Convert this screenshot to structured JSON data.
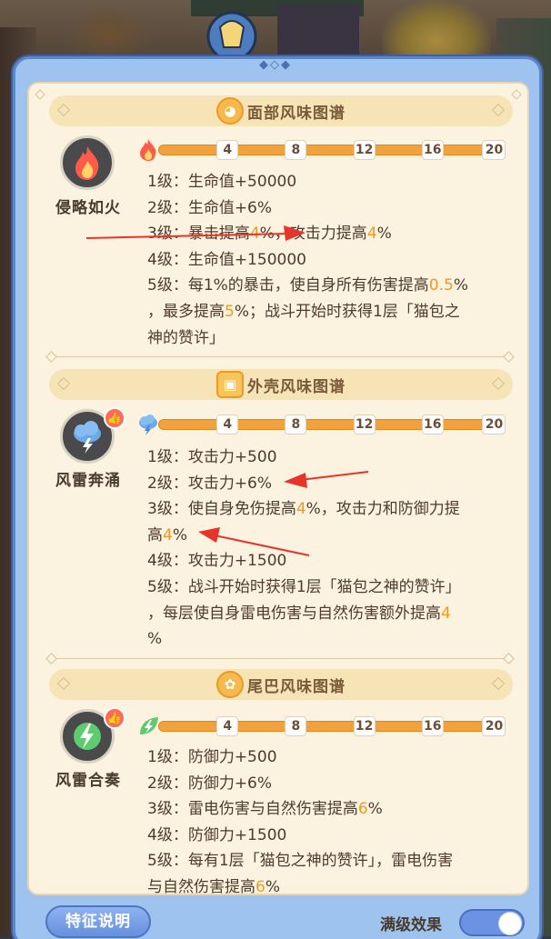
{
  "sections": [
    {
      "title": "面部风味图谱",
      "icon": "cat-face-icon",
      "emblem_name": "侵略如火",
      "emblem_icon": "flame-icon",
      "bar_icon": "flame-icon",
      "ticks": [
        "4",
        "8",
        "12",
        "16",
        "20"
      ],
      "levels": [
        {
          "prefix": "1级：生命值+50000"
        },
        {
          "prefix": "2级：生命值+6%"
        },
        {
          "prefix": "3级：暴击提高",
          "hl": "4",
          "suffix": "%，攻击力提高",
          "hl2": "4",
          "suffix2": "%"
        },
        {
          "prefix": "4级：生命值+150000"
        },
        {
          "prefix": "5级：每1%的暴击，使自身所有伤害提高",
          "hl": "0.5",
          "suffix": "%"
        },
        {
          "prefix": "，最多提高",
          "hl": "5",
          "suffix": "%；战斗开始时获得1层「猫包之"
        },
        {
          "prefix": "神的赞许」"
        }
      ]
    },
    {
      "title": "外壳风味图谱",
      "icon": "shell-box-icon",
      "emblem_name": "风雷奔涌",
      "emblem_icon": "storm-cloud-icon",
      "bar_icon": "storm-cloud-icon",
      "ticks": [
        "4",
        "8",
        "12",
        "16",
        "20"
      ],
      "levels": [
        {
          "prefix": "1级：攻击力+500"
        },
        {
          "prefix": "2级：攻击力+6%"
        },
        {
          "prefix": "3级：使自身免伤提高",
          "hl": "4",
          "suffix": "%，攻击力和防御力提"
        },
        {
          "prefix": "高",
          "hl": "4",
          "suffix": "%"
        },
        {
          "prefix": "4级：攻击力+1500"
        },
        {
          "prefix": "5级：战斗开始时获得1层「猫包之神的赞许」"
        },
        {
          "prefix": "，每层使自身雷电伤害与自然伤害额外提高",
          "hl": "4"
        },
        {
          "prefix": "%"
        }
      ]
    },
    {
      "title": "尾巴风味图谱",
      "icon": "tail-icon",
      "emblem_name": "风雷合奏",
      "emblem_icon": "lightning-leaf-icon",
      "bar_icon": "leaf-icon",
      "ticks": [
        "4",
        "8",
        "12",
        "16",
        "20"
      ],
      "levels": [
        {
          "prefix": "1级：防御力+500"
        },
        {
          "prefix": "2级：防御力+6%"
        },
        {
          "prefix": "3级：雷电伤害与自然伤害提高",
          "hl": "6",
          "suffix": "%"
        },
        {
          "prefix": "4级：防御力+1500"
        },
        {
          "prefix": "5级：每有1层「猫包之神的赞许」，雷电伤害"
        },
        {
          "prefix": "与自然伤害提高",
          "hl": "6",
          "suffix": "%"
        }
      ]
    }
  ],
  "footer": {
    "feature_button": "特征说明",
    "maxlvl_label": "满级效果",
    "toggle_on": true
  },
  "colors": {
    "highlight": "#f09a1f",
    "panel_blue": "#9ec3ee",
    "bar_orange": "#f2a23c"
  }
}
